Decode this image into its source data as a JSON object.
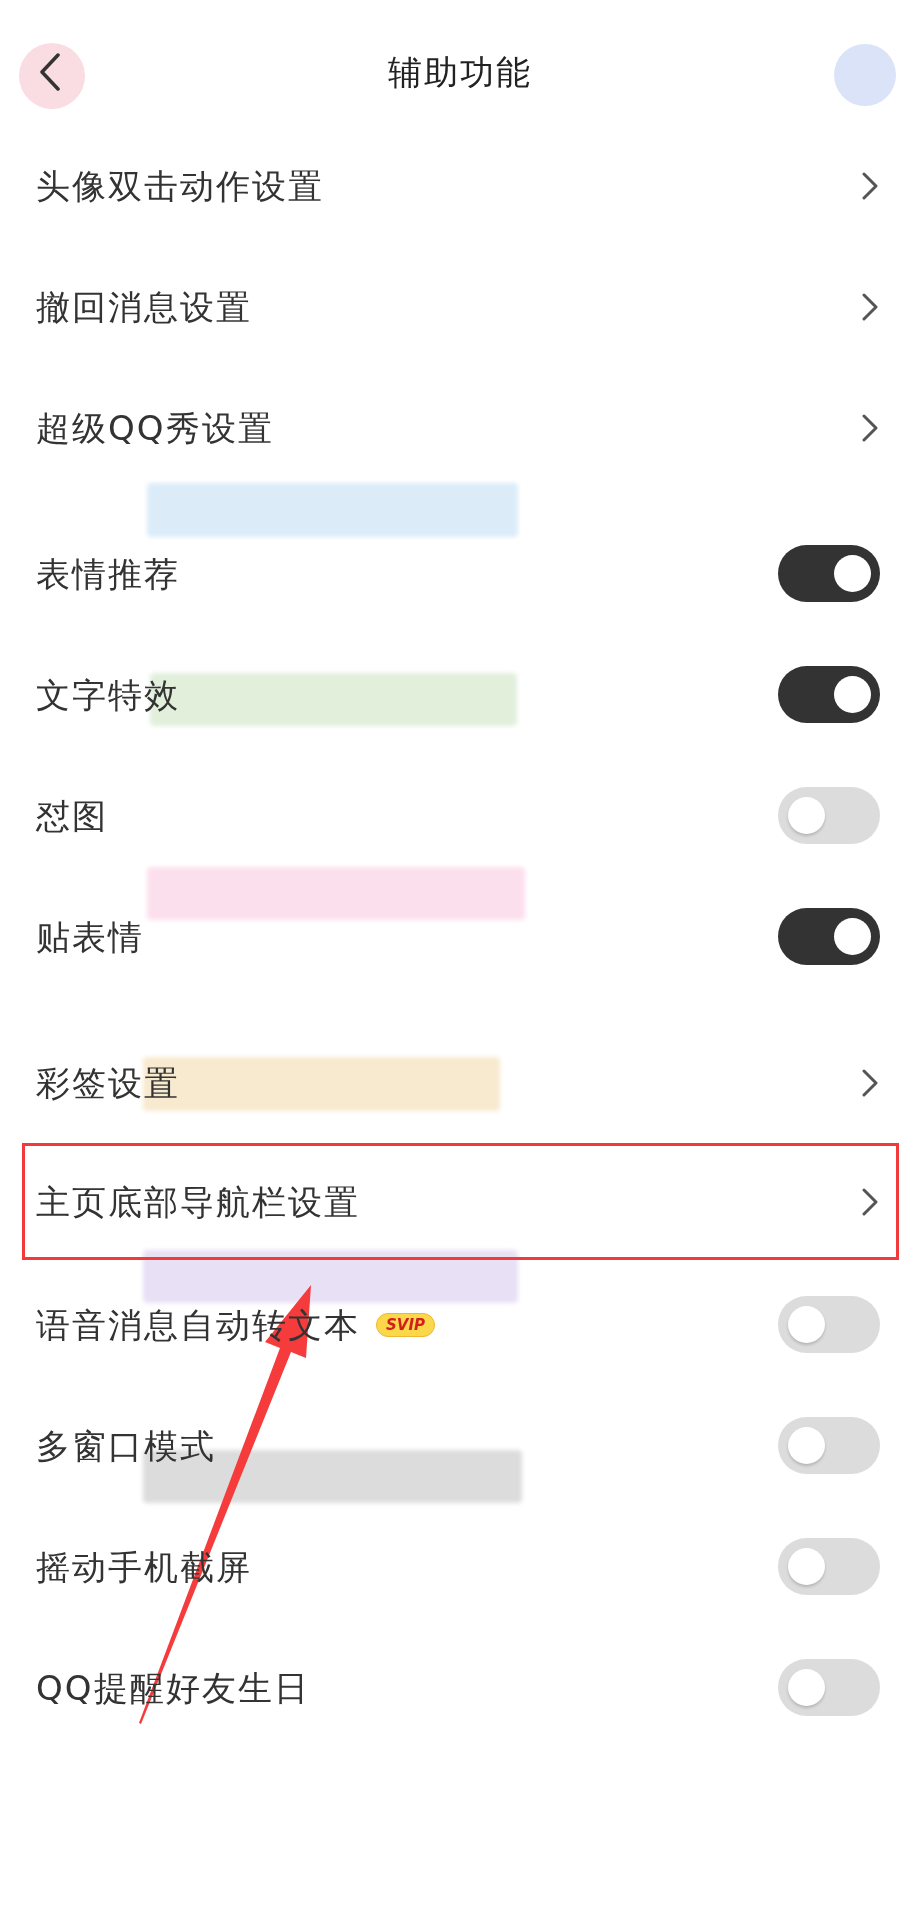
{
  "header": {
    "title": "辅助功能"
  },
  "sections": [
    {
      "items": [
        {
          "kind": "link",
          "label": "头像双击动作设置",
          "highlighted": false
        },
        {
          "kind": "link",
          "label": "撤回消息设置",
          "highlighted": false
        },
        {
          "kind": "link",
          "label": "超级QQ秀设置",
          "highlighted": false
        }
      ]
    },
    {
      "items": [
        {
          "kind": "toggle",
          "label": "表情推荐",
          "on": true
        },
        {
          "kind": "toggle",
          "label": "文字特效",
          "on": true
        },
        {
          "kind": "toggle",
          "label": "怼图",
          "on": false
        },
        {
          "kind": "toggle",
          "label": "贴表情",
          "on": true
        }
      ]
    },
    {
      "items": [
        {
          "kind": "link",
          "label": "彩签设置",
          "highlighted": false
        },
        {
          "kind": "link",
          "label": "主页底部导航栏设置",
          "highlighted": true
        },
        {
          "kind": "toggle",
          "label": "语音消息自动转文本",
          "badge": "SVIP",
          "on": false
        },
        {
          "kind": "toggle",
          "label": "多窗口模式",
          "on": false
        },
        {
          "kind": "toggle",
          "label": "摇动手机截屏",
          "on": false
        },
        {
          "kind": "toggle",
          "label": "QQ提醒好友生日",
          "on": false
        }
      ]
    }
  ],
  "pointer_arrow": true
}
